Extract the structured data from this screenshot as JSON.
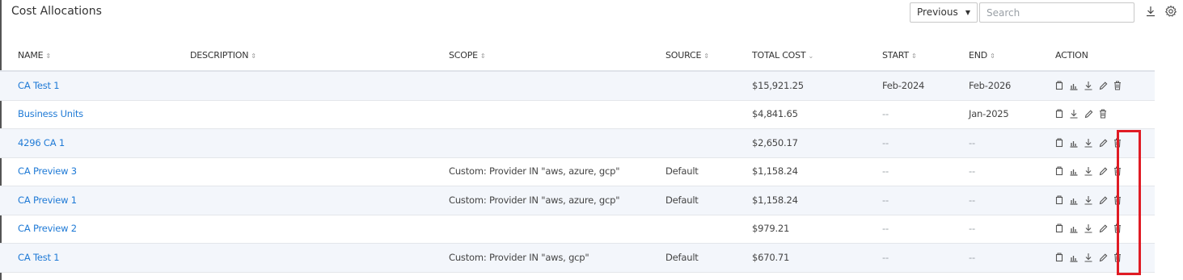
{
  "header": {
    "title": "Cost Allocations",
    "period_select": "Previous",
    "search_placeholder": "Search"
  },
  "icons": {
    "download": "download-icon",
    "settings": "gear-icon",
    "copy": "copy-icon",
    "chart": "bar-chart-icon",
    "edit": "pencil-icon",
    "delete": "trash-icon"
  },
  "table": {
    "columns": [
      {
        "label": "NAME",
        "sort": "⇕"
      },
      {
        "label": "DESCRIPTION",
        "sort": "⇕"
      },
      {
        "label": "SCOPE",
        "sort": "⇕"
      },
      {
        "label": "SOURCE",
        "sort": "⇕"
      },
      {
        "label": "TOTAL COST",
        "sort": "⌄"
      },
      {
        "label": "START",
        "sort": "⇕"
      },
      {
        "label": "END",
        "sort": "⇕"
      },
      {
        "label": "ACTION",
        "sort": ""
      }
    ],
    "rows": [
      {
        "name": "CA Test 1",
        "description": "",
        "scope": "",
        "source": "",
        "total_cost": "$15,921.25",
        "start": "Feb-2024",
        "end": "Feb-2026",
        "actions": [
          "copy",
          "chart",
          "download",
          "edit",
          "delete"
        ]
      },
      {
        "name": "Business Units",
        "description": "",
        "scope": "",
        "source": "",
        "total_cost": "$4,841.65",
        "start": "--",
        "end": "Jan-2025",
        "actions": [
          "copy",
          "download",
          "edit",
          "delete"
        ]
      },
      {
        "name": "4296 CA 1",
        "description": "",
        "scope": "",
        "source": "",
        "total_cost": "$2,650.17",
        "start": "--",
        "end": "--",
        "actions": [
          "copy",
          "chart",
          "download",
          "edit",
          "delete"
        ]
      },
      {
        "name": "CA Preview 3",
        "description": "",
        "scope": "Custom: Provider IN \"aws, azure, gcp\"",
        "source": "Default",
        "total_cost": "$1,158.24",
        "start": "--",
        "end": "--",
        "actions": [
          "copy",
          "chart",
          "download",
          "edit",
          "delete"
        ]
      },
      {
        "name": "CA Preview 1",
        "description": "",
        "scope": "Custom: Provider IN \"aws, azure, gcp\"",
        "source": "Default",
        "total_cost": "$1,158.24",
        "start": "--",
        "end": "--",
        "actions": [
          "copy",
          "chart",
          "download",
          "edit",
          "delete"
        ]
      },
      {
        "name": "CA Preview 2",
        "description": "",
        "scope": "",
        "source": "",
        "total_cost": "$979.21",
        "start": "--",
        "end": "--",
        "actions": [
          "copy",
          "chart",
          "download",
          "edit",
          "delete"
        ]
      },
      {
        "name": "CA Test 1",
        "description": "",
        "scope": "Custom: Provider IN \"aws, gcp\"",
        "source": "Default",
        "total_cost": "$670.71",
        "start": "--",
        "end": "--",
        "actions": [
          "copy",
          "chart",
          "download",
          "edit",
          "delete"
        ]
      }
    ]
  },
  "colors": {
    "link": "#1f7ad6",
    "row_alt": "#f3f6fb",
    "highlight": "#e01b24"
  }
}
